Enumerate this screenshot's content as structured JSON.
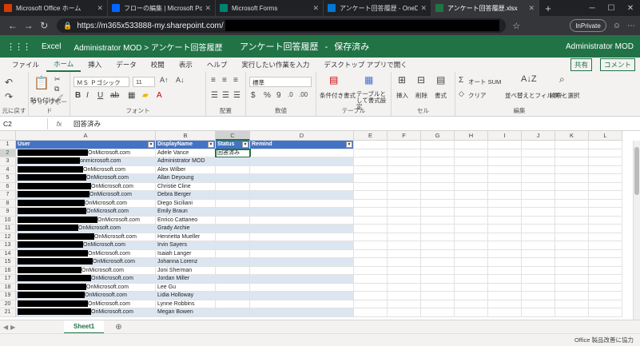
{
  "browser": {
    "tabs": [
      {
        "title": "Microsoft Office ホーム",
        "color": "#d83b01"
      },
      {
        "title": "フローの編集 | Microsoft Power A",
        "color": "#0066ff"
      },
      {
        "title": "Microsoft Forms",
        "color": "#008272"
      },
      {
        "title": "アンケート回答履歴 - OneDrive",
        "color": "#0078d4"
      },
      {
        "title": "アンケート回答履歴.xlsx",
        "color": "#217346"
      }
    ],
    "url": "https://m365x533888-my.sharepoint.com/",
    "inprivate": "InPrivate"
  },
  "excel": {
    "app": "Excel",
    "breadcrumb": "Administrator MOD > アンケート回答履歴",
    "doc_title": "アンケート回答履歴",
    "save_state": "保存済み",
    "user": "Administrator MOD"
  },
  "ribbon_tabs": [
    "ファイル",
    "ホーム",
    "挿入",
    "データ",
    "校閲",
    "表示",
    "ヘルプ",
    "実行したい作業を入力",
    "デスクトップ アプリで開く"
  ],
  "ribbon_right": {
    "share": "共有",
    "comment": "コメント"
  },
  "ribbon": {
    "undo_group": "元に戻す",
    "clipboard": {
      "paste": "貼り付け",
      "label": "クリップボード"
    },
    "font": {
      "name": "ＭＳ Ｐゴシック",
      "size": "11",
      "label": "フォント"
    },
    "alignment": {
      "label": "配置"
    },
    "number": {
      "format": "標準",
      "label": "数値"
    },
    "table": {
      "cond": "条件付き書式",
      "fmt": "テーブルとして書式設定",
      "label": "テーブル"
    },
    "cells": {
      "insert": "挿入",
      "delete": "削除",
      "format": "書式",
      "label": "セル"
    },
    "editing": {
      "autosum": "オート SUM",
      "clear": "クリア",
      "sort": "並べ替えとフィルター",
      "find": "検索と選択",
      "label": "編集"
    }
  },
  "formula_bar": {
    "name_box": "C2",
    "fx": "fx",
    "value": "回答済み"
  },
  "columns": [
    "A",
    "B",
    "C",
    "D",
    "E",
    "F",
    "G",
    "H",
    "I",
    "J",
    "K",
    "L"
  ],
  "table_headers": [
    "User",
    "DisplayName",
    "Status",
    "Remind"
  ],
  "rows": [
    {
      "num": "2",
      "email": "OnMicrosoft.com",
      "name": "Adele Vance",
      "status": "回答済み"
    },
    {
      "num": "3",
      "email": "onmicrosoft.com",
      "name": "Administrator MOD",
      "status": ""
    },
    {
      "num": "4",
      "email": "OnMicrosoft.com",
      "name": "Alex Wilber",
      "status": ""
    },
    {
      "num": "5",
      "email": "OnMicrosoft.com",
      "name": "Allan Deyoung",
      "status": ""
    },
    {
      "num": "6",
      "email": "OnMicrosoft.com",
      "name": "Christie Cline",
      "status": ""
    },
    {
      "num": "7",
      "email": "OnMicrosoft.com",
      "name": "Debra Berger",
      "status": ""
    },
    {
      "num": "8",
      "email": "OnMicrosoft.com",
      "name": "Diego Siciliani",
      "status": ""
    },
    {
      "num": "9",
      "email": "OnMicrosoft.com",
      "name": "Emily Braun",
      "status": ""
    },
    {
      "num": "10",
      "email": "OnMicrosoft.com",
      "name": "Enrico Cattaneo",
      "status": ""
    },
    {
      "num": "11",
      "email": "OnMicrosoft.com",
      "name": "Grady Archie",
      "status": ""
    },
    {
      "num": "12",
      "email": "OnMicrosoft.com",
      "name": "Henrietta Mueller",
      "status": ""
    },
    {
      "num": "13",
      "email": "OnMicrosoft.com",
      "name": "Irvin Sayers",
      "status": ""
    },
    {
      "num": "14",
      "email": "OnMicrosoft.com",
      "name": "Isaiah Langer",
      "status": ""
    },
    {
      "num": "15",
      "email": "OnMicrosoft.com",
      "name": "Johanna Lorenz",
      "status": ""
    },
    {
      "num": "16",
      "email": "OnMicrosoft.com",
      "name": "Joni Sherman",
      "status": ""
    },
    {
      "num": "17",
      "email": "OnMicrosoft.com",
      "name": "Jordan Miller",
      "status": ""
    },
    {
      "num": "18",
      "email": "OnMicrosoft.com",
      "name": "Lee Gu",
      "status": ""
    },
    {
      "num": "19",
      "email": "OnMicrosoft.com",
      "name": "Lidia Holloway",
      "status": ""
    },
    {
      "num": "20",
      "email": "OnMicrosoft.com",
      "name": "Lynne Robbins",
      "status": ""
    },
    {
      "num": "21",
      "email": "OnMicrosoft.com",
      "name": "Megan Bowen",
      "status": ""
    }
  ],
  "sheet": {
    "name": "Sheet1"
  },
  "status_bar": "Office 製品改善に協力"
}
